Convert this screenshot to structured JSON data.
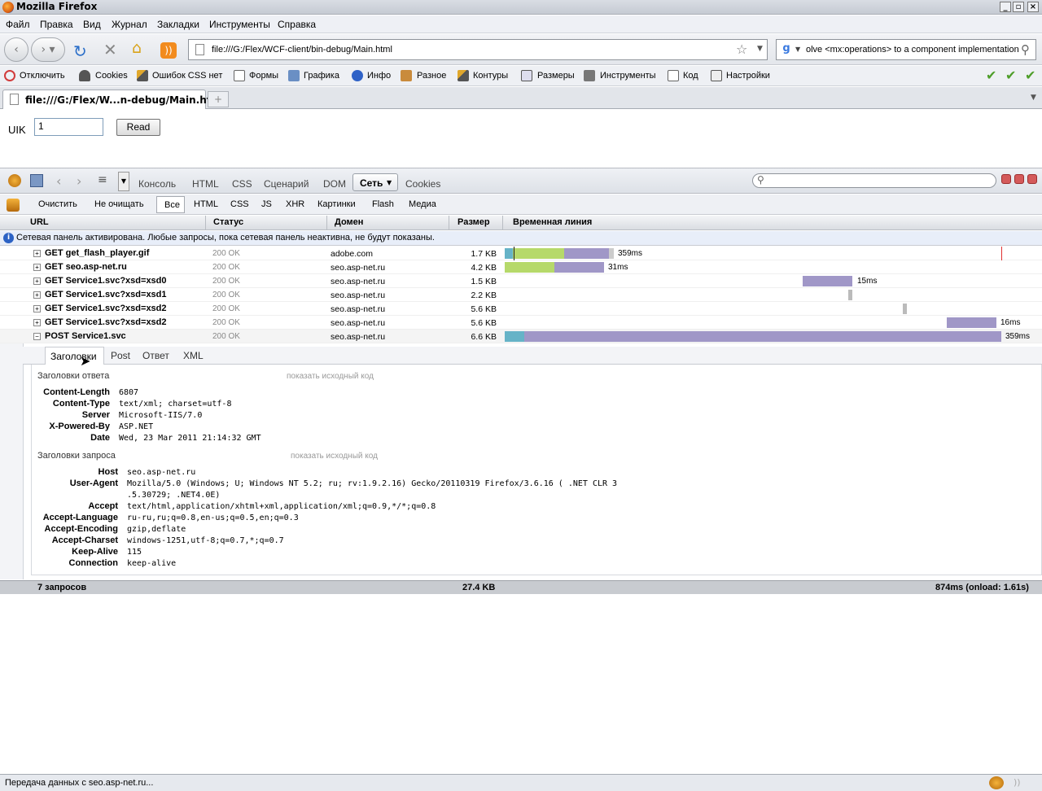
{
  "window": {
    "title": "Mozilla Firefox"
  },
  "menu": [
    "Файл",
    "Правка",
    "Вид",
    "Журнал",
    "Закладки",
    "Инструменты",
    "Справка"
  ],
  "nav": {
    "url": "file:///G:/Flex/WCF-client/bin-debug/Main.html",
    "search_value": "olve <mx:operations> to a component implementation"
  },
  "devbar": [
    "Отключить",
    "Cookies",
    "Ошибок CSS нет",
    "Формы",
    "Графика",
    "Инфо",
    "Разное",
    "Контуры",
    "Размеры",
    "Инструменты",
    "Код",
    "Настройки"
  ],
  "tab": {
    "title": "file:///G:/Flex/W...n-debug/Main.html"
  },
  "page": {
    "uik_label": "UIK",
    "uik_value": "1",
    "read_label": "Read"
  },
  "firebug": {
    "tabs": [
      "Консоль",
      "HTML",
      "CSS",
      "Сценарий",
      "DOM",
      "Сеть",
      "Cookies"
    ],
    "active_tab": "Сеть",
    "filter": {
      "clear": "Очистить",
      "persist": "Не очищать",
      "types": [
        "Все",
        "HTML",
        "CSS",
        "JS",
        "XHR",
        "Картинки",
        "Flash",
        "Медиа"
      ]
    },
    "columns": {
      "url": "URL",
      "status": "Статус",
      "domain": "Домен",
      "size": "Размер",
      "timeline": "Временная линия"
    },
    "info": "Сетевая панель активирована. Любые запросы, пока сетевая панель неактивна, не будут показаны.",
    "requests": [
      {
        "url": "GET get_flash_player.gif",
        "status": "200 OK",
        "domain": "adobe.com",
        "size": "1.7 KB",
        "time": "359ms"
      },
      {
        "url": "GET seo.asp-net.ru",
        "status": "200 OK",
        "domain": "seo.asp-net.ru",
        "size": "4.2 KB",
        "time": "31ms"
      },
      {
        "url": "GET Service1.svc?xsd=xsd0",
        "status": "200 OK",
        "domain": "seo.asp-net.ru",
        "size": "1.5 KB",
        "time": "15ms"
      },
      {
        "url": "GET Service1.svc?xsd=xsd1",
        "status": "200 OK",
        "domain": "seo.asp-net.ru",
        "size": "2.2 KB",
        "time": ""
      },
      {
        "url": "GET Service1.svc?xsd=xsd2",
        "status": "200 OK",
        "domain": "seo.asp-net.ru",
        "size": "5.6 KB",
        "time": ""
      },
      {
        "url": "GET Service1.svc?xsd=xsd2",
        "status": "200 OK",
        "domain": "seo.asp-net.ru",
        "size": "5.6 KB",
        "time": "16ms"
      },
      {
        "url": "POST Service1.svc",
        "status": "200 OK",
        "domain": "seo.asp-net.ru",
        "size": "6.6 KB",
        "time": "359ms"
      }
    ],
    "detail_tabs": [
      "Заголовки",
      "Post",
      "Ответ",
      "XML"
    ],
    "response_headers_title": "Заголовки ответа",
    "request_headers_title": "Заголовки запроса",
    "show_source": "показать исходный код",
    "response_headers": [
      {
        "k": "Content-Length",
        "v": "6807"
      },
      {
        "k": "Content-Type",
        "v": "text/xml; charset=utf-8"
      },
      {
        "k": "Server",
        "v": "Microsoft-IIS/7.0"
      },
      {
        "k": "X-Powered-By",
        "v": "ASP.NET"
      },
      {
        "k": "Date",
        "v": "Wed, 23 Mar 2011 21:14:32 GMT"
      }
    ],
    "request_headers": [
      {
        "k": "Host",
        "v": "seo.asp-net.ru"
      },
      {
        "k": "User-Agent",
        "v": "Mozilla/5.0 (Windows; U; Windows NT 5.2; ru; rv:1.9.2.16) Gecko/20110319 Firefox/3.6.16 ( .NET CLR 3",
        "v2": ".5.30729; .NET4.0E)"
      },
      {
        "k": "Accept",
        "v": "text/html,application/xhtml+xml,application/xml;q=0.9,*/*;q=0.8"
      },
      {
        "k": "Accept-Language",
        "v": "ru-ru,ru;q=0.8,en-us;q=0.5,en;q=0.3"
      },
      {
        "k": "Accept-Encoding",
        "v": "gzip,deflate"
      },
      {
        "k": "Accept-Charset",
        "v": "windows-1251,utf-8;q=0.7,*;q=0.7"
      },
      {
        "k": "Keep-Alive",
        "v": "115"
      },
      {
        "k": "Connection",
        "v": "keep-alive"
      }
    ],
    "summary": {
      "count": "7 запросов",
      "size": "27.4 KB",
      "time": "874ms (onload: 1.61s)"
    }
  },
  "status": "Передача данных с seo.asp-net.ru..."
}
